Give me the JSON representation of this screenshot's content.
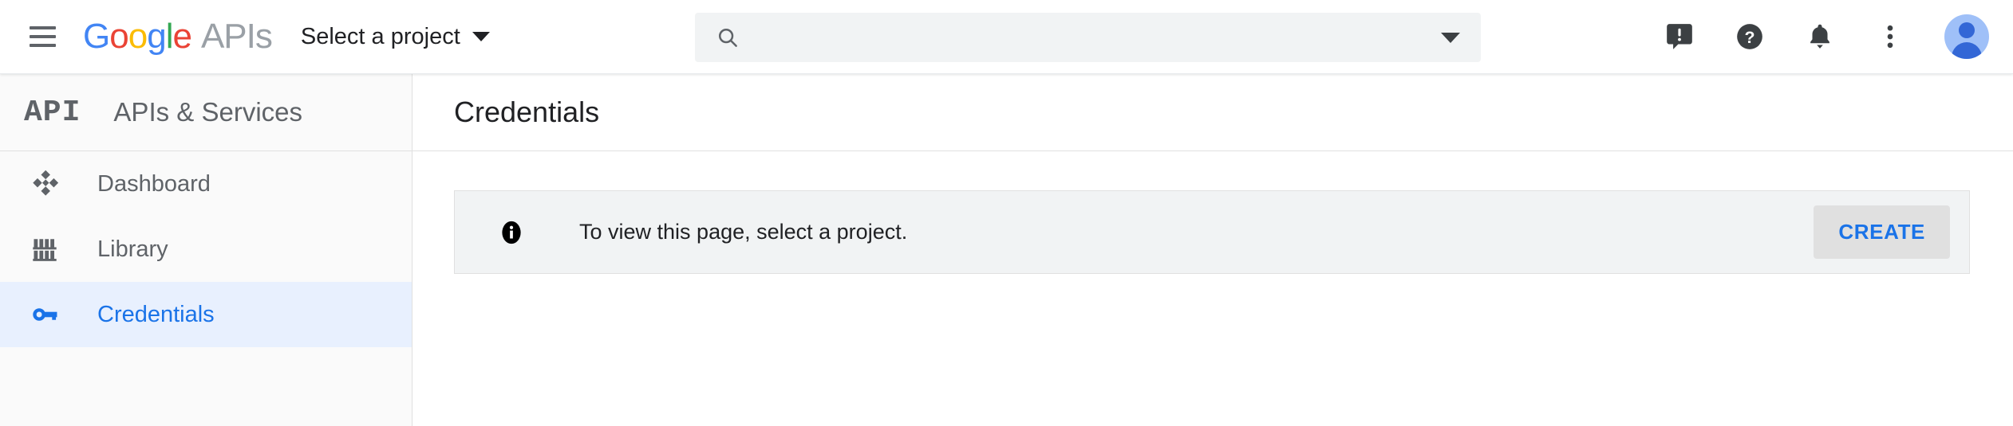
{
  "header": {
    "menu_icon": "hamburger-icon",
    "brand": {
      "google_letters": [
        "G",
        "o",
        "o",
        "g",
        "l",
        "e"
      ],
      "suffix": "APIs"
    },
    "project_picker": {
      "label": "Select a project",
      "caret_icon": "chevron-down-icon"
    },
    "search": {
      "value": "",
      "placeholder": "",
      "icon": "search-icon",
      "caret_icon": "chevron-down-icon"
    },
    "actions": [
      {
        "name": "feedback-icon",
        "title": "Send feedback"
      },
      {
        "name": "help-icon",
        "title": "Help"
      },
      {
        "name": "notifications-icon",
        "title": "Notifications"
      },
      {
        "name": "more-vert-icon",
        "title": "More options"
      }
    ],
    "avatar": {
      "name": "avatar",
      "title": "Account"
    }
  },
  "sidebar": {
    "badge": "API",
    "title": "APIs & Services",
    "items": [
      {
        "label": "Dashboard",
        "icon": "dashboard-icon",
        "selected": false
      },
      {
        "label": "Library",
        "icon": "library-icon",
        "selected": false
      },
      {
        "label": "Credentials",
        "icon": "key-icon",
        "selected": true
      }
    ]
  },
  "main": {
    "page_title": "Credentials",
    "banner": {
      "icon": "info-icon",
      "message": "To view this page, select a project.",
      "action_label": "CREATE"
    }
  },
  "colors": {
    "accent_blue": "#1a73e8",
    "selected_bg": "#e8f0fe",
    "sidebar_bg": "#fafafa",
    "banner_bg": "#f1f3f4",
    "search_bg": "#f1f3f4",
    "text_primary": "#202124",
    "text_secondary": "#5f6368",
    "google_blue": "#4285f4",
    "google_red": "#ea4335",
    "google_yellow": "#fbbc05",
    "google_green": "#34a853",
    "apis_gray": "#9aa0a6"
  }
}
